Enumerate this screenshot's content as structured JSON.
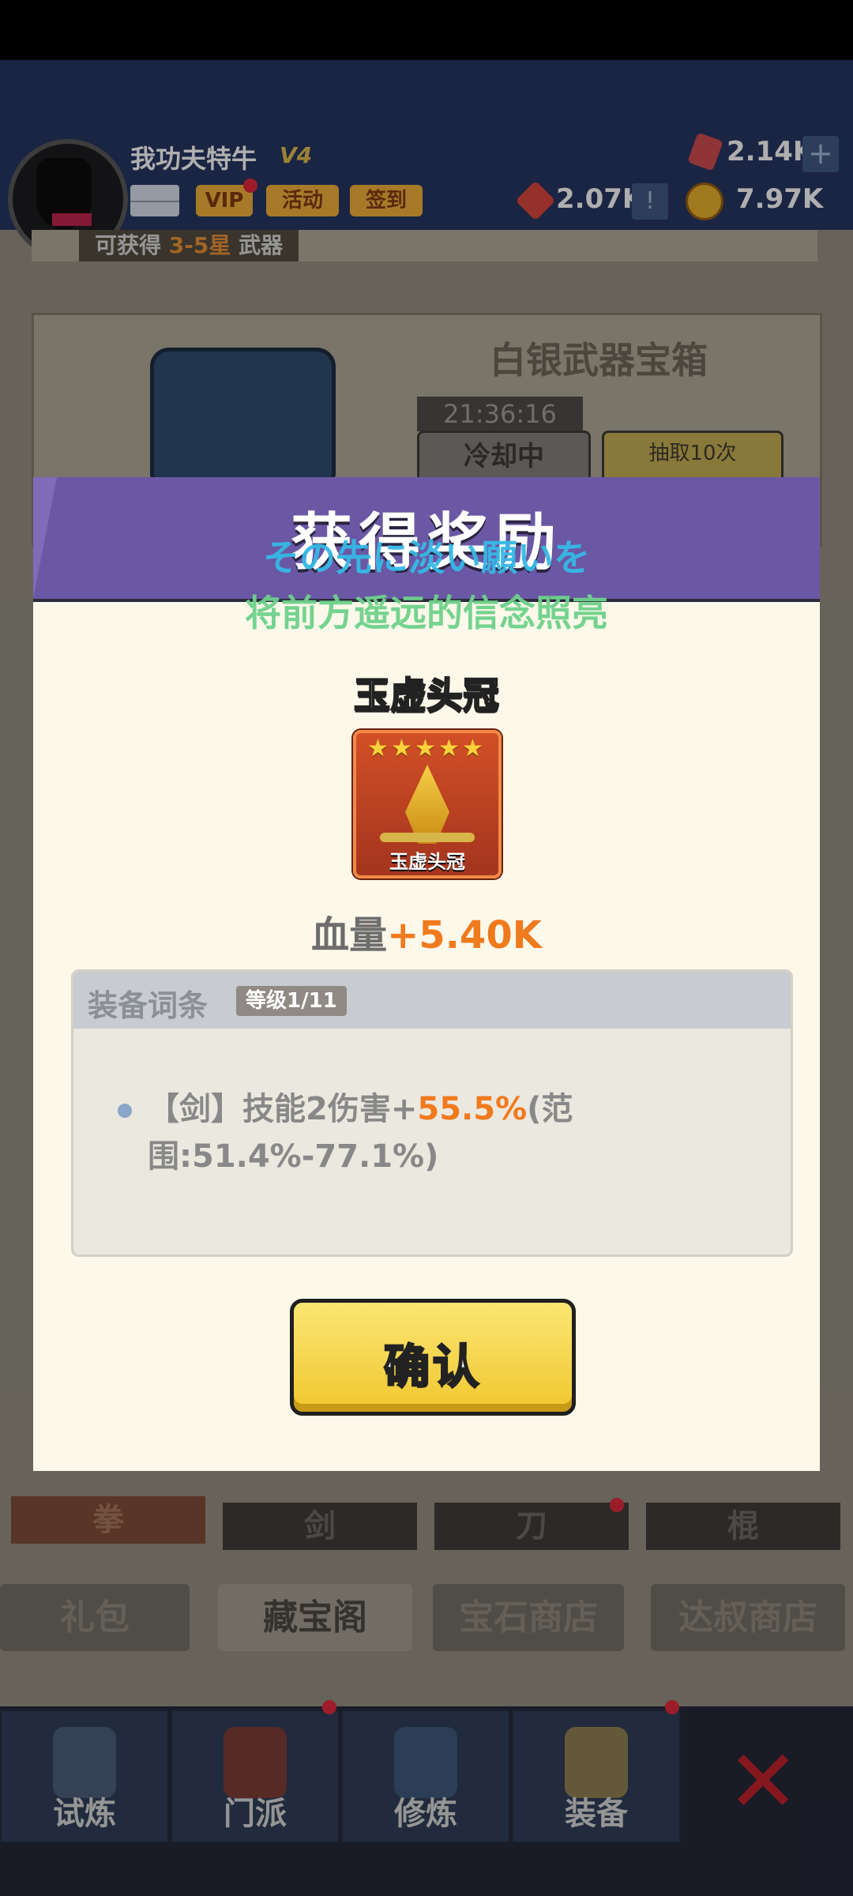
{
  "header": {
    "player_name": "我功夫特牛",
    "vip_level": "V4",
    "vip_label": "VIP",
    "events_label": "活动",
    "signin_label": "签到",
    "gems": "2.14K",
    "tokens": "2.07K",
    "coins": "7.97K"
  },
  "chest": {
    "reward_hint_prefix": "可获得",
    "reward_hint_stars": "3-5星",
    "reward_hint_suffix": "武器",
    "title": "白银武器宝箱",
    "timer": "21:36:16",
    "cooldown_label": "冷却中",
    "draw10_label": "抽取10次"
  },
  "weapon_tabs": [
    "拳",
    "剑",
    "刀",
    "棍"
  ],
  "shop_tabs": [
    "礼包",
    "藏宝阁",
    "宝石商店",
    "达叔商店"
  ],
  "bottom_nav": [
    "试炼",
    "门派",
    "修炼",
    "装备"
  ],
  "dialog": {
    "title": "获得奖励",
    "lyric_line1": "その先に淡い願いを",
    "lyric_line2": "将前方遥远的信念照亮",
    "item_name": "玉虚头冠",
    "item_card_label": "玉虚头冠",
    "item_stars": 5,
    "stat_label": "血量",
    "stat_value": "+5.40K",
    "affix_title": "装备词条",
    "affix_level": "等级1/11",
    "affix_prefix": "【剑】技能2伤害+",
    "affix_value": "55.5%",
    "affix_suffix": "(范围:51.4%-77.1%)",
    "confirm_label": "确认"
  },
  "colors": {
    "dialog_header": "#6b58a4",
    "dialog_body": "#fcf8ea",
    "highlight": "#f07a1e",
    "confirm_button": "#f0c72f",
    "lyric1": "#36b9e6",
    "lyric2": "#6ed28b"
  }
}
